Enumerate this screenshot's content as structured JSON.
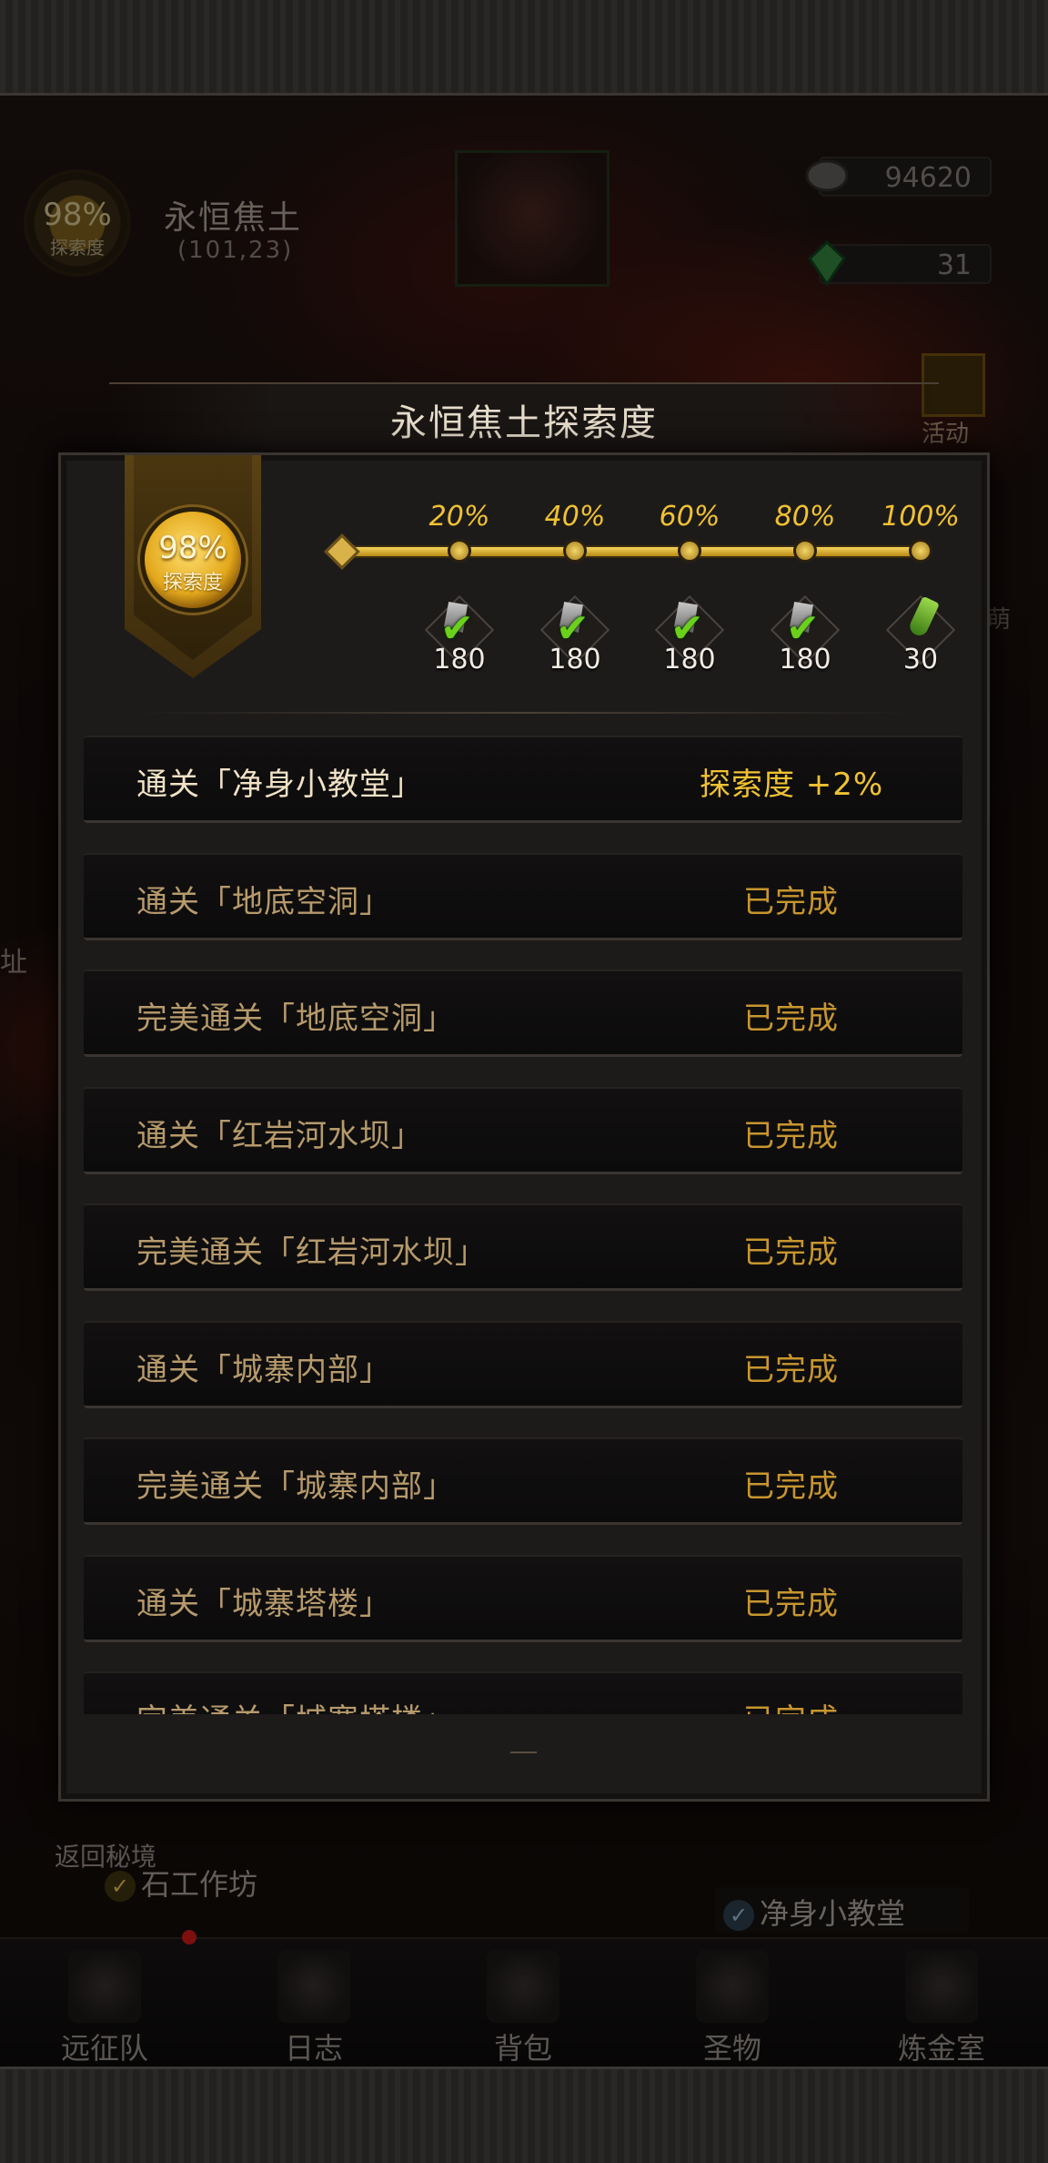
{
  "header": {
    "region_progress": "98%",
    "region_progress_label": "探索度",
    "region_name": "永恒焦土",
    "region_coords": "(101,23)"
  },
  "resources": [
    {
      "icon": "ore-gem-icon",
      "value": "94620"
    },
    {
      "icon": "green-gem-icon",
      "value": "31"
    }
  ],
  "activity": {
    "label": "活动"
  },
  "side_text_left": "址",
  "side_text_right": "萌",
  "modal": {
    "title": "永恒焦土探索度",
    "progress": 0.98,
    "progress_text": "98%",
    "progress_label": "探索度",
    "milestones": [
      {
        "label": "20%",
        "reward_icon": "stone-icon",
        "qty": "180",
        "claimed": true
      },
      {
        "label": "40%",
        "reward_icon": "stone-icon",
        "qty": "180",
        "claimed": true
      },
      {
        "label": "60%",
        "reward_icon": "stone-icon",
        "qty": "180",
        "claimed": true
      },
      {
        "label": "80%",
        "reward_icon": "stone-icon",
        "qty": "180",
        "claimed": true
      },
      {
        "label": "100%",
        "reward_icon": "potion-icon",
        "qty": "30",
        "claimed": false
      }
    ],
    "tasks": [
      {
        "title": "通关「净身小教堂」",
        "status": "探索度 +2%",
        "active": true
      },
      {
        "title": "通关「地底空洞」",
        "status": "已完成"
      },
      {
        "title": "完美通关「地底空洞」",
        "status": "已完成"
      },
      {
        "title": "通关「红岩河水坝」",
        "status": "已完成"
      },
      {
        "title": "完美通关「红岩河水坝」",
        "status": "已完成"
      },
      {
        "title": "通关「城寨内部」",
        "status": "已完成"
      },
      {
        "title": "完美通关「城寨内部」",
        "status": "已完成"
      },
      {
        "title": "通关「城寨塔楼」",
        "status": "已完成"
      },
      {
        "title": "完美通关「城寨塔楼」",
        "status": "已完成"
      }
    ]
  },
  "bottom": {
    "return_label": "返回秘境",
    "quest_left": "石工作坊",
    "quest_right": "净身小教堂"
  },
  "nav": [
    {
      "label": "远征队",
      "icon": "helmet-icon"
    },
    {
      "label": "日志",
      "icon": "map-scroll-icon"
    },
    {
      "label": "背包",
      "icon": "backpack-icon"
    },
    {
      "label": "圣物",
      "icon": "chalice-icon"
    },
    {
      "label": "炼金室",
      "icon": "alchemy-icon"
    }
  ],
  "colors": {
    "gold": "#f0c232",
    "completed": "#c7962f",
    "panel": "#1d1b1a",
    "check": "#6ad01c"
  }
}
